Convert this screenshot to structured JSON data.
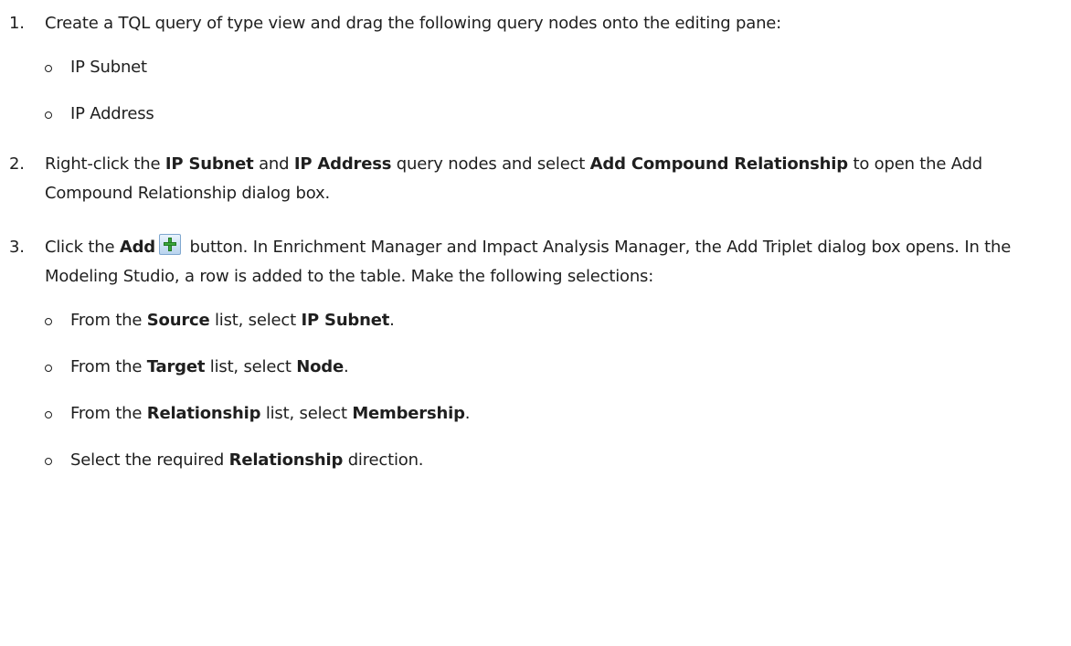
{
  "steps": [
    {
      "number": "1.",
      "text": "Create a TQL query of type view and drag the following query nodes onto the editing pane:",
      "sub_items": [
        {
          "text": "IP Subnet"
        },
        {
          "text": "IP Address"
        }
      ]
    },
    {
      "number": "2.",
      "p1": "Right-click the ",
      "b1": "IP Subnet",
      "p2": " and ",
      "b2": "IP Address",
      "p3": " query nodes and select ",
      "b3": "Add Compound Relationship",
      "p4": " to open the Add Compound Relationship dialog box."
    },
    {
      "number": "3.",
      "p1": "Click the ",
      "b1": "Add",
      "icon": "add-plus-icon",
      "p2": " button. In Enrichment Manager and Impact Analysis Manager, the Add Triplet dialog box opens. In the Modeling Studio, a row is added to the table. Make the following selections:",
      "sub_items": [
        {
          "p1": "From the ",
          "b1": "Source",
          "p2": " list, select ",
          "b2": "IP Subnet",
          "p3": "."
        },
        {
          "p1": "From the ",
          "b1": "Target",
          "p2": " list, select ",
          "b2": "Node",
          "p3": "."
        },
        {
          "p1": "From the ",
          "b1": "Relationship",
          "p2": " list, select ",
          "b2": "Membership",
          "p3": "."
        },
        {
          "p1": "Select the required ",
          "b1": "Relationship",
          "p2": " direction."
        }
      ]
    }
  ]
}
